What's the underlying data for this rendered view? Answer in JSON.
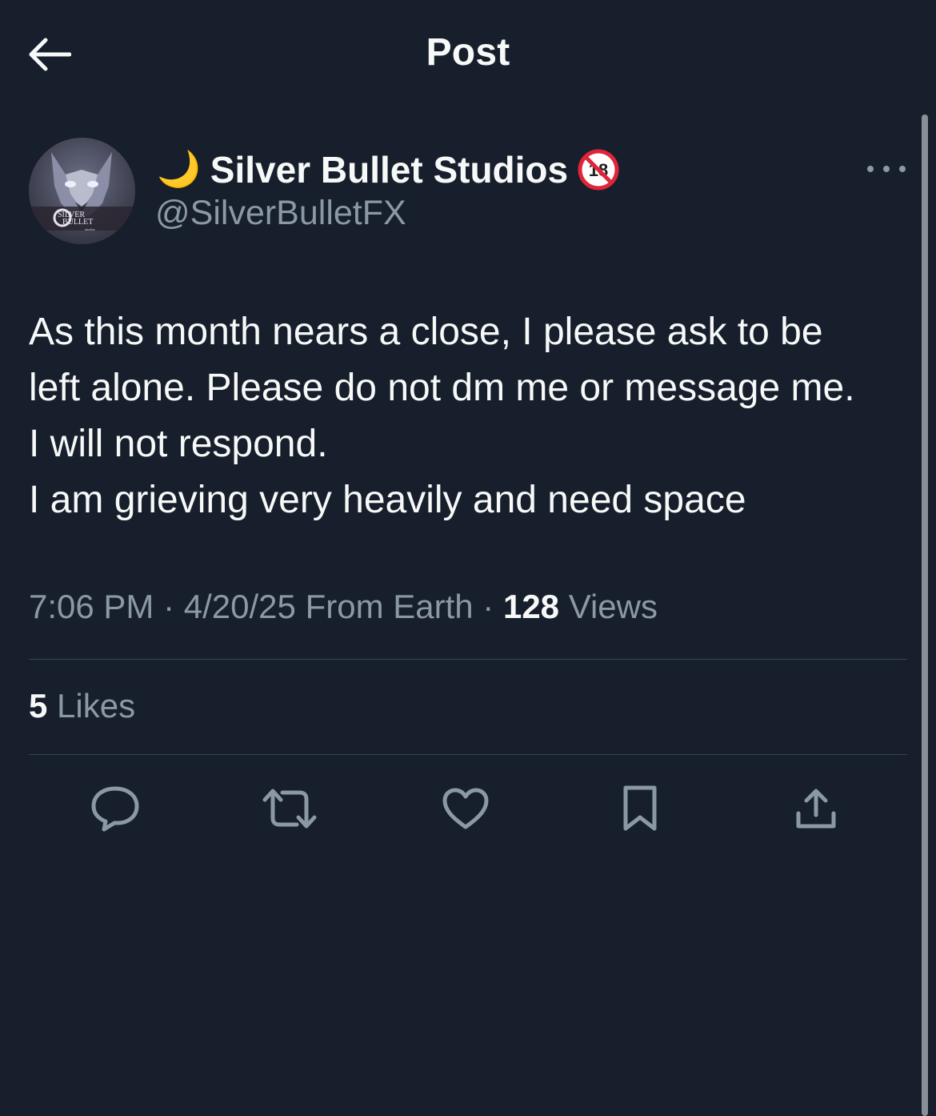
{
  "header": {
    "title": "Post",
    "back_icon": "arrow-left-icon"
  },
  "post": {
    "author": {
      "emoji": "🌙",
      "display_name": "Silver Bullet Studios",
      "badge": "no-under-18-icon",
      "handle": "@SilverBulletFX",
      "avatar_text_line1": "SILVER",
      "avatar_text_line2": "BULLET",
      "avatar_text_line3": "studios"
    },
    "text_lines": [
      "As this month nears a close, I please ask to be",
      "left alone. Please do not dm me or message me.",
      "I will not respond.",
      "I am grieving very heavily and need space"
    ],
    "meta": {
      "time": "7:06 PM",
      "date": "4/20/25",
      "location": "From Earth",
      "sep": "·",
      "views_count": "128",
      "views_label": "Views"
    },
    "likes": {
      "count": "5",
      "label": "Likes"
    }
  },
  "actions": [
    {
      "icon": "reply-icon"
    },
    {
      "icon": "repost-icon"
    },
    {
      "icon": "like-icon"
    },
    {
      "icon": "bookmark-icon"
    },
    {
      "icon": "share-icon"
    }
  ],
  "colors": {
    "background": "#161f2b",
    "primary_text": "#f7f9f9",
    "secondary_text": "#8b98a5",
    "divider": "#38444d"
  }
}
